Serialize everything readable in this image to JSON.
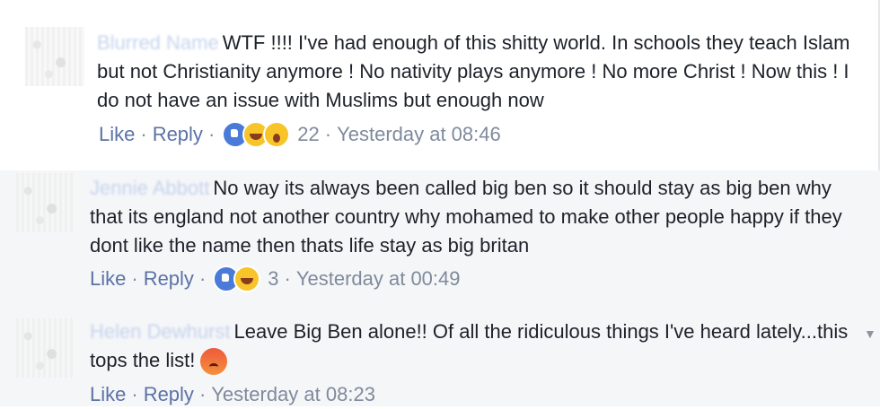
{
  "comments": [
    {
      "name": "Blurred Name",
      "text": "WTF !!!! I've had enough of this shitty world. In schools they teach Islam but not Christianity anymore ! No nativity plays anymore ! No more Christ ! Now this ! I do not have an issue with Muslims but enough now",
      "like": "Like",
      "reply": "Reply",
      "sep": "·",
      "reactions": [
        "like",
        "haha",
        "wow"
      ],
      "count": "22",
      "time": "Yesterday at 08:46"
    },
    {
      "name": "Jennie Abbott",
      "text": "No way its always been called big ben so it should stay as big ben why that its england not another country why mohamed to make other people happy if they dont like the name then thats life stay as big britan",
      "like": "Like",
      "reply": "Reply",
      "sep": "·",
      "reactions": [
        "like",
        "haha"
      ],
      "count": "3",
      "time": "Yesterday at 00:49"
    },
    {
      "name": "Helen Dewhurst",
      "text": "Leave Big Ben alone!! Of all the ridiculous things I've heard lately...this tops the list!",
      "like": "Like",
      "reply": "Reply",
      "sep": "·",
      "time": "Yesterday at 08:23"
    }
  ],
  "colors": {
    "link": "#5b72a6",
    "meta": "#7f8a9c",
    "text": "#1d2129",
    "reply_bg": "#f5f6f8"
  },
  "icons": [
    "like-reaction-icon",
    "haha-reaction-icon",
    "wow-reaction-icon",
    "angry-emoji-icon",
    "chevron-down-icon"
  ]
}
